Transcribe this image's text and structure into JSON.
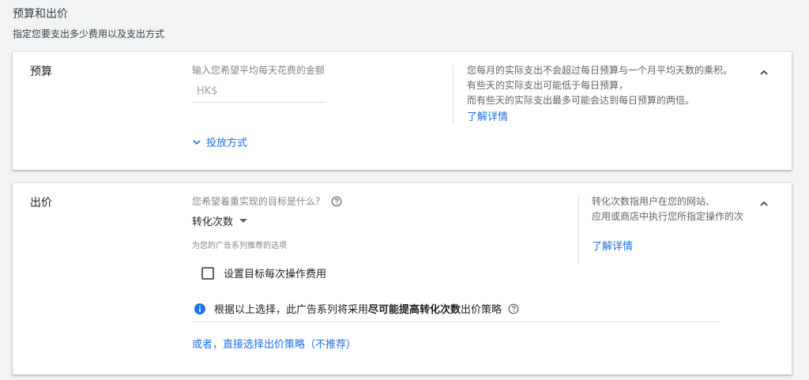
{
  "header": {
    "title": "预算和出价",
    "subtitle": "指定您要支出多少费用以及支出方式"
  },
  "budget": {
    "label": "预算",
    "input_label": "输入您希望平均每天花费的金额",
    "currency_prefix": "HK$",
    "input_value": "",
    "delivery_method": "投放方式",
    "help_lines": [
      "您每月的实际支出不会超过每日预算与一个月平均天数的乘积。",
      "有些天的实际支出可能低于每日预算，",
      "而有些天的实际支出最多可能会达到每日预算的两倍。"
    ],
    "learn_more": "了解详情"
  },
  "bidding": {
    "label": "出价",
    "goal_question": "您希望着重实现的目标是什么？",
    "goal_selected": "转化次数",
    "recommended_note": "为您的广告系列推荐的选项",
    "target_cpa_checkbox": "设置目标每次操作费用",
    "target_cpa_checked": false,
    "info_prefix": "根据以上选择，此广告系列将采用",
    "info_strategy": "尽可能提高转化次数",
    "info_suffix": "出价策略",
    "alt_link": "或者，直接选择出价策略（不推荐）",
    "help_lines": [
      "转化次数指用户在您的网站、",
      "应用或商店中执行您所指定操作的次"
    ],
    "learn_more": "了解详情"
  },
  "colors": {
    "accent": "#1a73e8",
    "background": "#f1f3f4",
    "card": "#ffffff",
    "muted_text": "#80868b"
  },
  "icons": {
    "collapse": "chevron-up-icon",
    "expand": "chevron-down-icon",
    "help": "help-circle-icon",
    "info": "info-icon",
    "dropdown": "dropdown-arrow-icon"
  }
}
